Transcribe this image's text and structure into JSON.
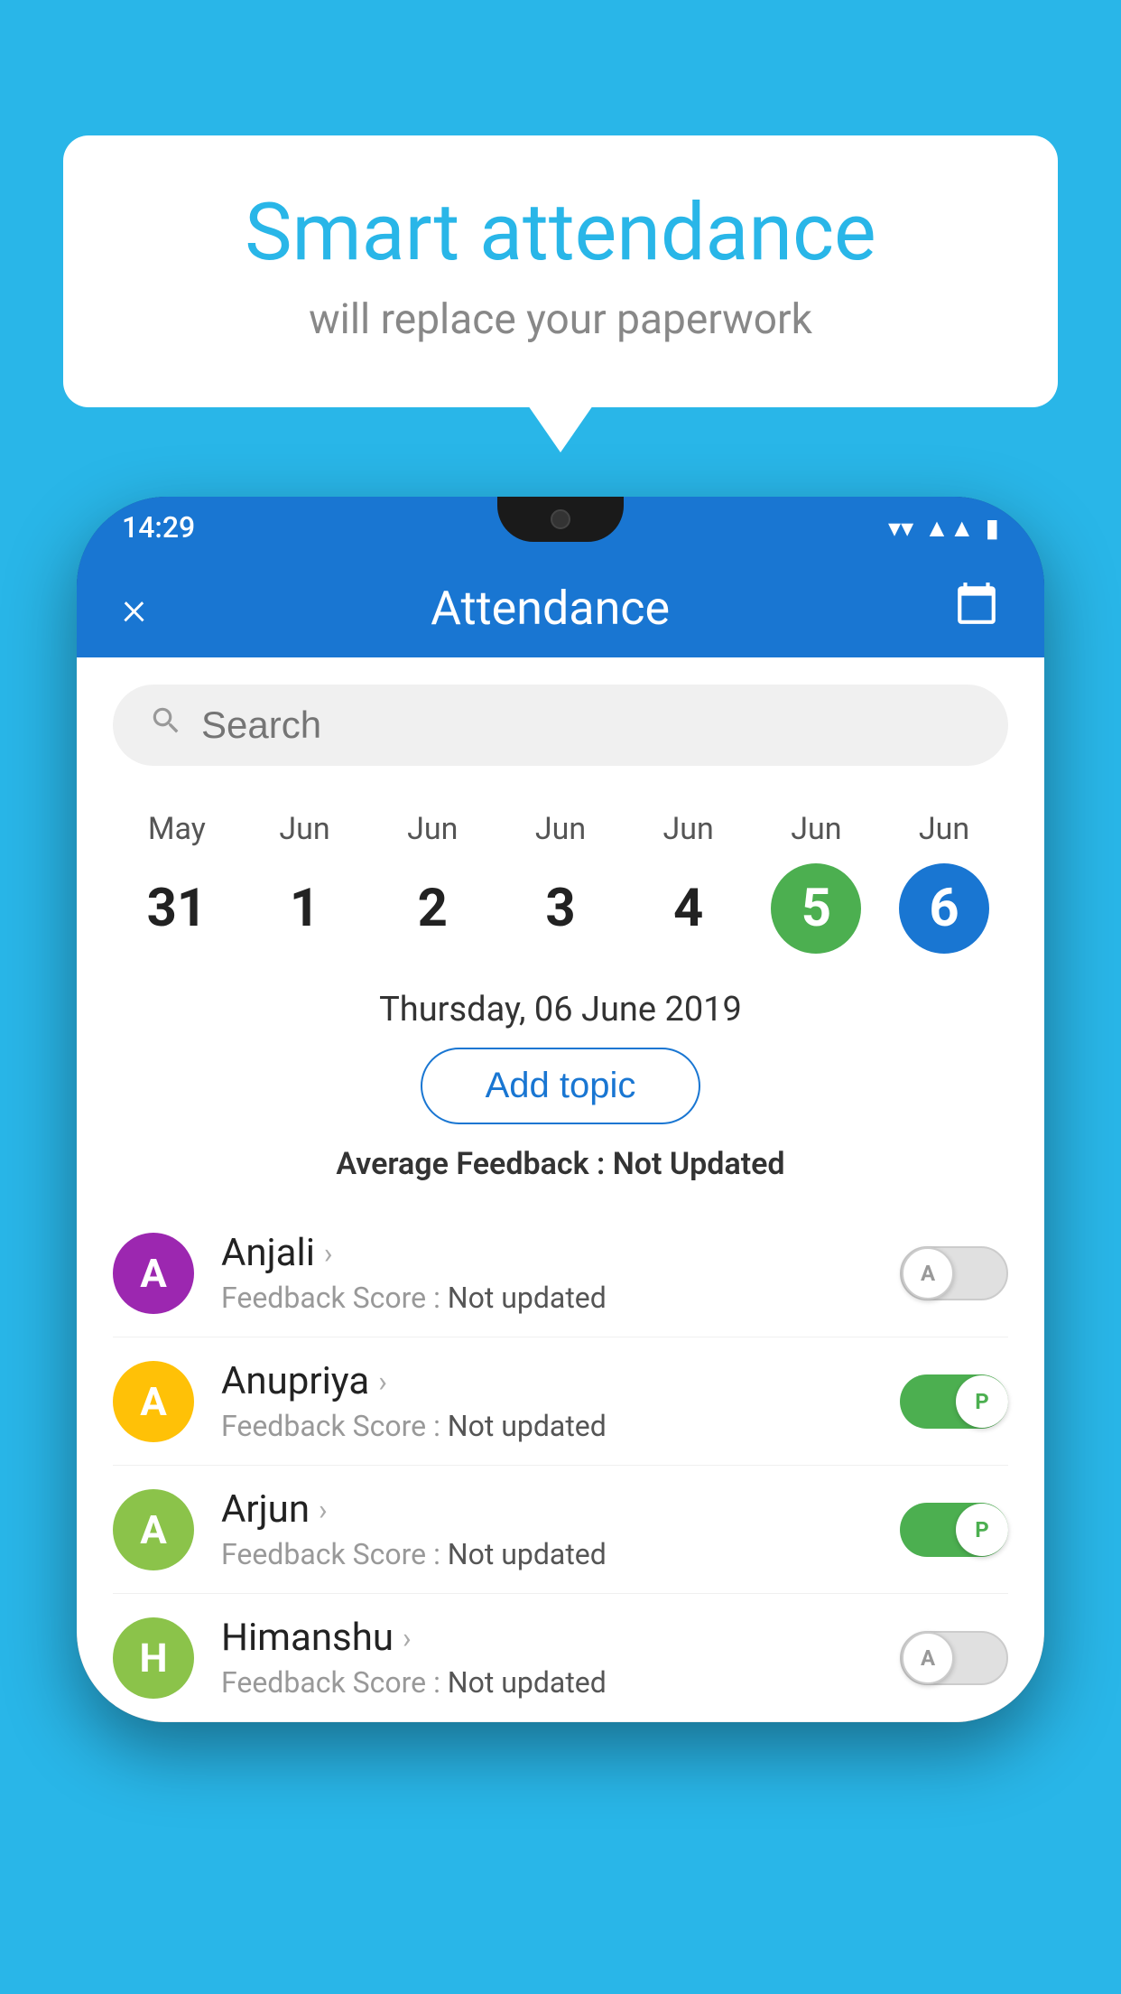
{
  "background_color": "#29B6E8",
  "speech_bubble": {
    "title": "Smart attendance",
    "subtitle": "will replace your paperwork"
  },
  "status_bar": {
    "time": "14:29",
    "icons": [
      "wifi",
      "signal",
      "battery"
    ]
  },
  "app_bar": {
    "title": "Attendance",
    "close_label": "×",
    "calendar_icon": "📅"
  },
  "search": {
    "placeholder": "Search"
  },
  "calendar": {
    "days": [
      {
        "month": "May",
        "num": "31",
        "state": "normal"
      },
      {
        "month": "Jun",
        "num": "1",
        "state": "normal"
      },
      {
        "month": "Jun",
        "num": "2",
        "state": "normal"
      },
      {
        "month": "Jun",
        "num": "3",
        "state": "normal"
      },
      {
        "month": "Jun",
        "num": "4",
        "state": "normal"
      },
      {
        "month": "Jun",
        "num": "5",
        "state": "today"
      },
      {
        "month": "Jun",
        "num": "6",
        "state": "selected"
      }
    ]
  },
  "selected_date": "Thursday, 06 June 2019",
  "add_topic_label": "Add topic",
  "avg_feedback_label": "Average Feedback :",
  "avg_feedback_value": "Not Updated",
  "students": [
    {
      "name": "Anjali",
      "avatar_letter": "A",
      "avatar_color": "#9C27B0",
      "feedback": "Not updated",
      "toggle_state": "off",
      "toggle_letter": "A"
    },
    {
      "name": "Anupriya",
      "avatar_letter": "A",
      "avatar_color": "#FFC107",
      "feedback": "Not updated",
      "toggle_state": "on",
      "toggle_letter": "P"
    },
    {
      "name": "Arjun",
      "avatar_letter": "A",
      "avatar_color": "#8BC34A",
      "feedback": "Not updated",
      "toggle_state": "on",
      "toggle_letter": "P"
    },
    {
      "name": "Himanshu",
      "avatar_letter": "H",
      "avatar_color": "#8BC34A",
      "feedback": "Not updated",
      "toggle_state": "off",
      "toggle_letter": "A"
    }
  ]
}
